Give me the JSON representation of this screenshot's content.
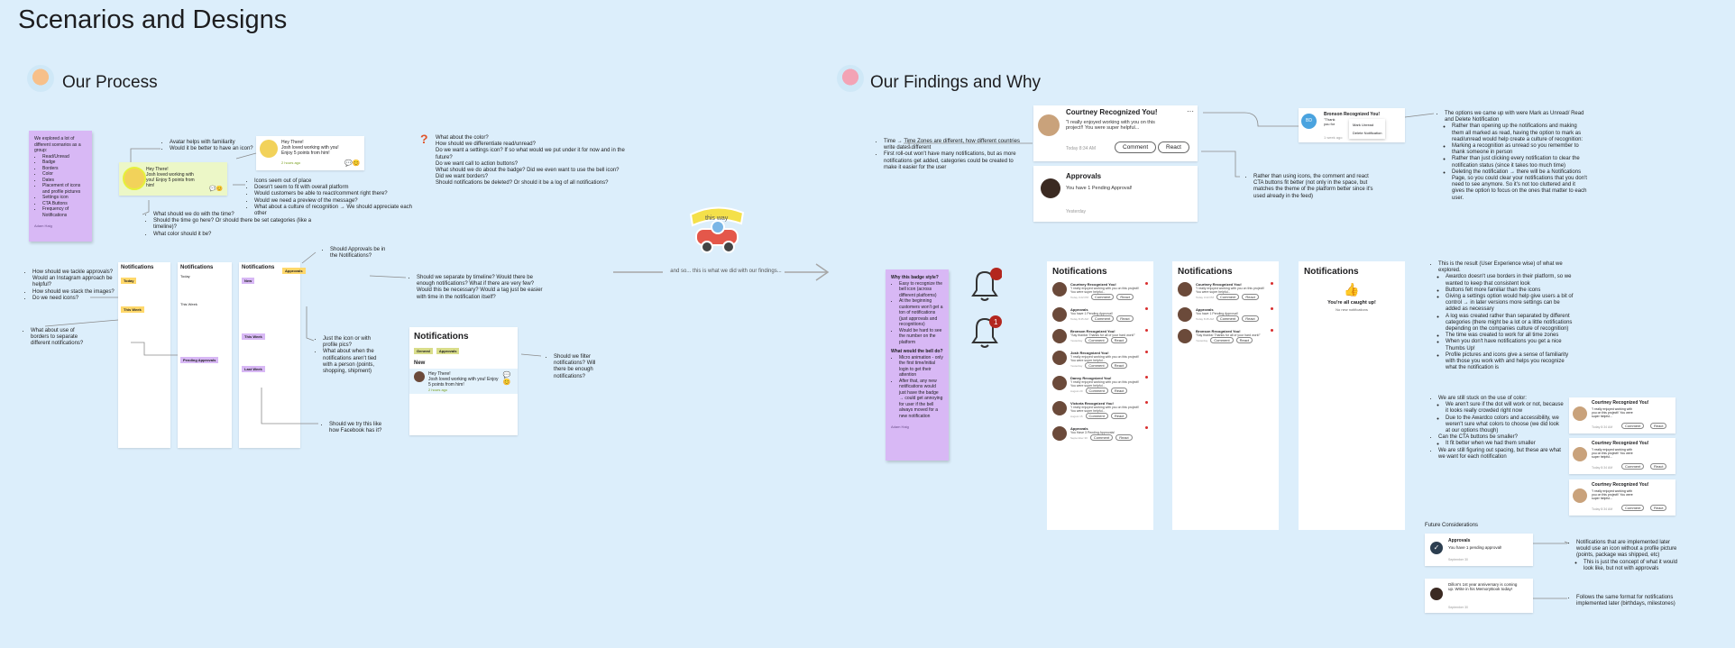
{
  "page_title": "Scenarios and Designs",
  "sections": {
    "process": "Our Process",
    "findings": "Our Findings and Why"
  },
  "process": {
    "sticky1": {
      "intro": "We explored a lot of different scenarios as a group:",
      "items": [
        "Read/Unread",
        "Badge",
        "Borders",
        "Color",
        "Dates",
        "Placement of icons and profile pictures",
        "Settings icon",
        "CTA Buttons",
        "Frequency of Notifications"
      ],
      "signature": "Adam Haig"
    },
    "avatar_notes": [
      "Avatar helps with familiarity",
      "Would it be better to have an icon?"
    ],
    "icon_notes": [
      "Icons seem out of place",
      "Doesn't seem to fit with overall platform",
      "Would customers be able to react/comment right there?",
      "Would we need a preview of the message?",
      "What about a culture of recognition → We should appreciate each other"
    ],
    "time_notes": [
      "What should we do with the time?",
      "Should the time go here? Or should there be set categories (like a timeline)?",
      "What color should it be?"
    ],
    "color_notes": [
      "What about the color?",
      "How should we differentiate read/unread?",
      "Do we want a settings icon? If so what would we put under it for now and in the future?",
      "Do we want call to action buttons?",
      "What should we do about the badge? Did we even want to use the bell icon?",
      "Did we want borders?",
      "Should notifications be deleted? Or should it be a log of all notifications?"
    ],
    "tackle_notes": [
      "How should we tackle approvals? Would an Instagram approach be helpful?",
      "How should we stack the images?",
      "Do we need icons?"
    ],
    "borders_notes": [
      "What about use of borders to separate different notifications?"
    ],
    "approvals_notes": [
      "Should Approvals be in the Notifications?"
    ],
    "timeline_notes": [
      "Should we separate by timeline? Would there be enough notifications? What if there are very few? Would this be necessary? Would a tag just be easier with time in the notification itself?"
    ],
    "profile_notes": [
      "Just the icon or with profile pics?",
      "What about when the notifications aren't tied with a person (points, shopping, shipment)"
    ],
    "facebook_notes": [
      "Should we try this like how Facebook has it?"
    ],
    "filter_notes": [
      "Should we filter notifications? Will there be enough notifications?"
    ],
    "mock": {
      "greeting": "Hey There!",
      "msg": "Josh loved working with you! Enjoy 5 points from him!",
      "time": "2 hours ago"
    },
    "filter_mock": {
      "title": "Notifications",
      "tabs": [
        "General",
        "Approvals"
      ],
      "new_label": "New",
      "greeting": "Hey There!",
      "msg": "Josh loved working with you! Enjoy 5 points from him!",
      "time": "2 hours ago"
    },
    "wireframes": [
      {
        "title": "Notifications",
        "sections": [
          "Today",
          "This Week"
        ]
      },
      {
        "title": "Notifications",
        "sections": [
          "Today",
          "This Week",
          "Pending Approvals"
        ]
      },
      {
        "title": "Notifications",
        "sections": [
          "New",
          "This Week",
          "Last Week"
        ],
        "tag": "Approvals"
      }
    ]
  },
  "transition": {
    "text": "and so... this is what we did with our findings...",
    "banner": "this way"
  },
  "findings": {
    "sticky2": {
      "q1": "Why this badge style?",
      "q1_items": [
        "Easy to recognize the bell icon (across different platforms)",
        "At the beginning customers won't get a ton of notifications (just approvals and recognitions)",
        "Would be hard to see the number on the platform"
      ],
      "q2": "What would the bell do?",
      "q2_items": [
        "Micro animation - only the first time/initial login to get their attention",
        "After that, any new notifications would just have the badge → could get annoying for user if the bell always moved for a new notification"
      ],
      "signature": "Adam Haig"
    },
    "bell_count": "1",
    "timezone_notes": [
      "Time → Time Zones are different, how different countries write dates different",
      "First roll-out won't have many notifications, but as more notifications get added, categories could be created to make it easier for the user"
    ],
    "icons_notes": [
      "Rather than using icons, the comment and react CTA buttons fit better (not only in the space, but matches the theme of the platform better since it's used already in the feed)"
    ],
    "mark_notes": {
      "lead": "The options we came up with were Mark as Unread/ Read and Delete Notification",
      "items": [
        "Rather than opening up the notifications and making them all marked as read, having the option to mark as read/unread would help create a culture of recognition:",
        "Marking a recognition as unread so you remember to thank someone in person",
        "Rather than just clicking every notification to clear the notification status (since it takes too much time)",
        "Deleting the notification → there will be a Notifications Page, so you could clear your notifications that you don't need to see anymore. So it's not too cluttered and it gives the option to focus on the ones that matter to each user."
      ]
    },
    "ux_notes": {
      "lead": "This is the result (User Experience wise) of what we explored.",
      "items": [
        "Awardco doesn't use borders in their platform, so we wanted to keep that consistent look",
        "Buttons felt more familiar than the icons",
        "Giving a settings option would help give users a bit of control → in later versions more settings can be added as necessary",
        "A log was created rather than separated by different categories (there might be a lot or a little notifications depending on the companies culture of recognition)",
        "The time was created to work for all time zones",
        "When you don't have notifications you get a nice Thumbs Up!",
        "Profile pictures and icons give a sense of familiarity with those you work with and helps you recognize what the notification is"
      ]
    },
    "color_notes": {
      "lead": "We are still stuck on the use of color:",
      "items": [
        "We aren't sure if the dot will work or not, because it looks really crowded right now",
        "Due to the Awardco colors and accessibility, we weren't sure what colors to choose (we did look at our options though)"
      ],
      "lead2": "Can the CTA buttons be smaller?",
      "items2": [
        "It fit better when we had them smaller"
      ],
      "lead3": "We are still figuring out spacing, but these are what we want for each notification"
    },
    "future_title": "Future Considerations",
    "future_notes1": [
      "Notifications that are implemented later would use an icon without a profile picture (points, package was shipped, etc)",
      "This is just the concept of what it would look like, but not with approvals"
    ],
    "future_notes2": [
      "Follows the same format for notifications implemented later (birthdays, milestones)"
    ],
    "future_card1": {
      "title": "Approvals",
      "body": "You have 1 pending approval!",
      "date": "September 30"
    },
    "future_card2": {
      "body": "Dillon's 1st year anniversary is coming up. Write in his MemoryBook today!",
      "date": "September 30"
    },
    "big_card1": {
      "name": "Courtney Recognized You!",
      "body": "\"I really enjoyed working with you on this project!! You were super helpful...",
      "date": "Today 8:34 AM",
      "comment": "Comment",
      "react": "React"
    },
    "big_card2": {
      "name": "Approvals",
      "body": "You have 1 Pending Approval!",
      "date": "Yesterday"
    },
    "menu_card": {
      "name": "Bronson Recognized You!",
      "body": "\"Thank you for being flexible! I know you had a lot...",
      "date": "1 week ago",
      "initials": "BD",
      "menu": [
        "Mark Unread",
        "Delete Notification"
      ]
    },
    "panel1": {
      "title": "Notifications",
      "items": [
        {
          "name": "Courtney Recognized You!",
          "body": "\"I really enjoyed working with you on this project!! You were super helpful...",
          "date": "Today 3:22 PM"
        },
        {
          "name": "Approvals",
          "body": "You have 1 Pending Approval!",
          "date": "Today 8:45 AM"
        },
        {
          "name": "Bronson Recognized You!",
          "body": "\"Say thanks! Thanks for all of your hard work!\"",
          "date": "Yesterday"
        },
        {
          "name": "Josh Recognized You!",
          "body": "\"I really enjoyed working with you on this project!! You were super helpful...",
          "date": "Yesterday"
        },
        {
          "name": "Danny Recognized You!",
          "body": "\"I really enjoyed working with you on this project!! You were super helpful...",
          "date": "August 29"
        },
        {
          "name": "Victoria Recognized You!",
          "body": "\"I really enjoyed working with you on this project!! You were super helpful...",
          "date": "August 15"
        },
        {
          "name": "Approvals",
          "body": "You Have 3 Pending Approvals!",
          "date": "September 30"
        }
      ],
      "comment": "Comment",
      "react": "React"
    },
    "panel2": {
      "title": "Notifications",
      "items": [
        {
          "name": "Courtney Recognized You!",
          "body": "\"I really enjoyed working with you on this project!! You were super helpful...",
          "date": "Today 3:22 PM"
        },
        {
          "name": "Approvals",
          "body": "You have 1 Pending Approval!",
          "date": "Today 8:45 AM"
        },
        {
          "name": "Bronson Recognized You!",
          "body": "\"Say thanks! Thanks for all of your hard work!\"",
          "date": "Yesterday"
        }
      ]
    },
    "panel3": {
      "title": "Notifications",
      "caught_up": "You're all caught up!",
      "sub": "No new notifications"
    },
    "right_cards": [
      {
        "name": "Courtney Recognized You!",
        "body": "\"I really enjoyed working with you on this project!! You were super helpful...",
        "date": "Today 8:34 AM"
      },
      {
        "name": "Courtney Recognized You!",
        "body": "\"I really enjoyed working with you on this project!! You were super helpful...",
        "date": "Today 8:34 AM"
      },
      {
        "name": "Courtney Recognized You!",
        "body": "\"I really enjoyed working with you on this project!! You were super helpful...",
        "date": "Today 8:34 AM"
      }
    ]
  }
}
